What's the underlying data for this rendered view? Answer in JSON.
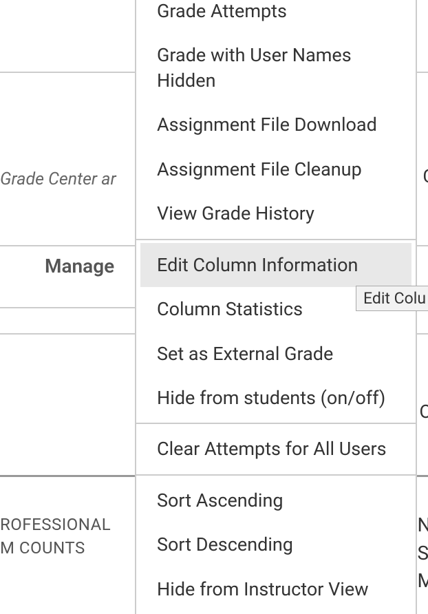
{
  "background": {
    "grade_center_text": "Grade Center ar",
    "manage_label": "Manage",
    "right_peek_1": "C",
    "right_peek_o": "O",
    "col_header_line1": "ROFESSIONAL",
    "col_header_line2": "M COUNTS",
    "right_col_line1": "N",
    "right_col_line2": "S",
    "right_col_line3": "M"
  },
  "menu": {
    "section1": [
      "Grade Attempts",
      "Grade with User Names Hidden",
      "Assignment File Download",
      "Assignment File Cleanup",
      "View Grade History"
    ],
    "section2": [
      "Edit Column Information",
      "Column Statistics",
      "Set as External Grade",
      "Hide from students (on/off)"
    ],
    "section3": [
      "Clear Attempts for All Users"
    ],
    "section4": [
      "Sort Ascending",
      "Sort Descending",
      "Hide from Instructor View"
    ]
  },
  "tooltip": {
    "text": "Edit Colu"
  }
}
